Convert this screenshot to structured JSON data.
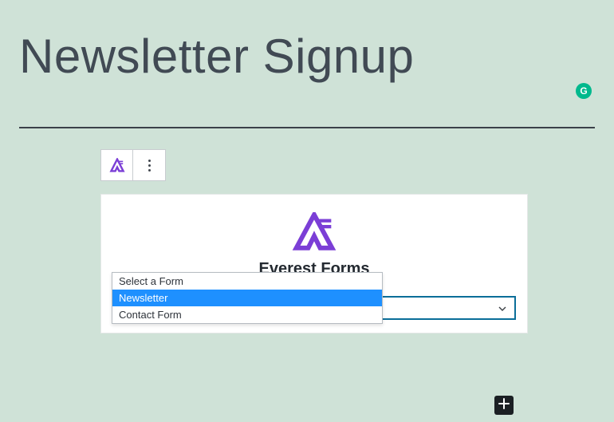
{
  "page_title": "Newsletter Signup",
  "grammarly_badge": "G",
  "toolbar": {
    "logo_icon": "everest-logo",
    "more_icon": "more-vertical"
  },
  "block": {
    "brand_title": "Everest Forms",
    "select_placeholder": "Select a Form",
    "dropdown": {
      "options": [
        {
          "label": "Select a Form",
          "selected": false
        },
        {
          "label": "Newsletter",
          "selected": true
        },
        {
          "label": "Contact Form",
          "selected": false
        }
      ]
    }
  },
  "add_block_icon": "plus"
}
